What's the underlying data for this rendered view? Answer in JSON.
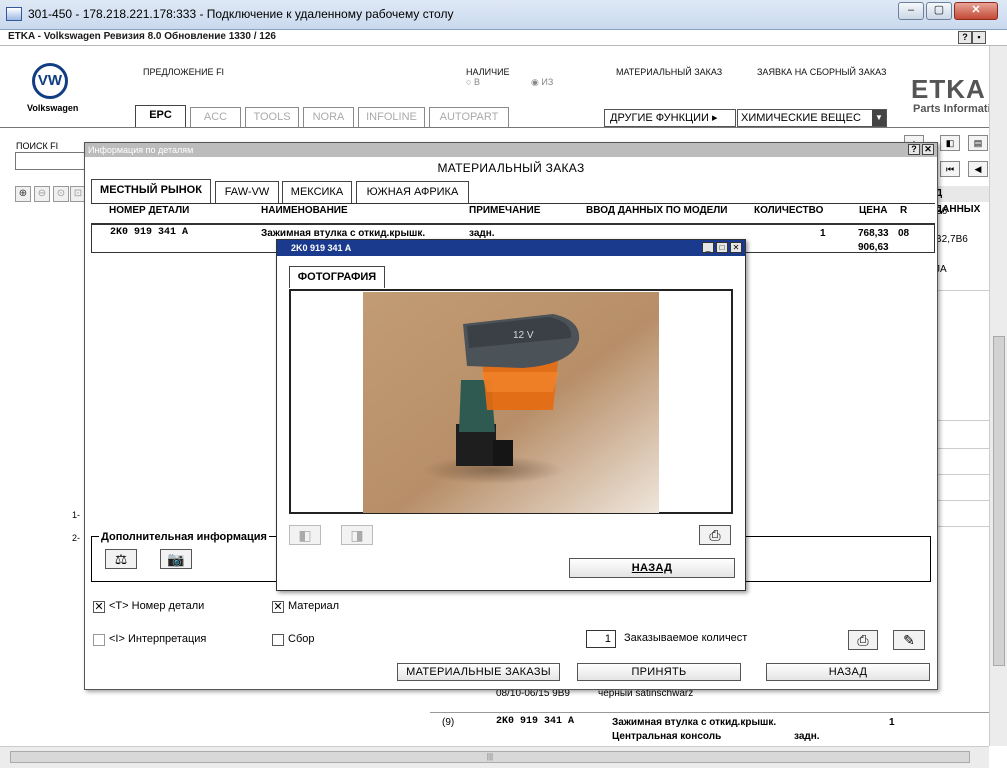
{
  "rdp": {
    "title": "301-450 - 178.218.221.178:333 - Подключение к удаленному рабочему столу"
  },
  "app": {
    "title": "ETKA - Volkswagen Ревизия 8.0 Обновление 1330 / 126"
  },
  "header": {
    "brand": "Volkswagen",
    "brand_logo": "VW",
    "proposal_fi": "ПРЕДЛОЖЕНИЕ FI",
    "availability": "НАЛИЧИЕ",
    "avail_in": "В",
    "avail_from": "ИЗ",
    "material_order": "МАТЕРИАЛЬНЫЙ ЗАКАЗ",
    "assembly_request": "ЗАЯВКА НА СБОРНЫЙ ЗАКАЗ",
    "etka_logo": "ETKA",
    "etka_sub": "Parts Informati",
    "other_functions": "ДРУГИЕ ФУНКЦИИ ▸",
    "chemicals": "ХИМИЧЕСКИЕ ВЕЩЕС"
  },
  "tabs": [
    "EPC",
    "ACC",
    "TOOLS",
    "NORA",
    "INFOLINE",
    "AUTOPART"
  ],
  "search": {
    "label": "ПОИСК FI"
  },
  "background_right": [
    "Д ДАННЫХ",
    "B6",
    "B2,7B6",
    "JA"
  ],
  "background_left": [
    "1-",
    "2-"
  ],
  "background_bottom": {
    "row1_years": "08/10-06/15 9B9",
    "row1_desc": "чёрный satinschwarz",
    "row2_pos": "(9)",
    "row2_part": "2K0 919 341 A",
    "row2_name": "Зажимная втулка с откид.крышк.",
    "row2_qty": "1",
    "row2_sub": "Центральная консоль",
    "row2_note": "задн."
  },
  "main_dialog": {
    "title": "Информация по деталям",
    "heading": "МАТЕРИАЛЬНЫЙ ЗАКАЗ",
    "markets": [
      "МЕСТНЫЙ РЫНОК",
      "FAW-VW",
      "МЕКСИКА",
      "ЮЖНАЯ АФРИКА"
    ],
    "columns": {
      "part_no": "НОМЕР ДЕТАЛИ",
      "name": "НАИМЕНОВАНИЕ",
      "note": "ПРИМЕЧАНИЕ",
      "model_data": "ВВОД ДАННЫХ ПО МОДЕЛИ",
      "qty": "КОЛИЧЕСТВО",
      "price": "ЦЕНА",
      "r": "R"
    },
    "row": {
      "part_no": "2K0 919 341 A",
      "name": "Зажимная втулка с откид.крышк.",
      "note": "задн.",
      "qty": "1",
      "price1": "768,33",
      "price2": "906,63",
      "r": "08"
    },
    "additional_info": "Дополнительная информация",
    "chk_part_no": "<T> Номер детали",
    "chk_material": "Материал",
    "chk_interpretation": "<I> Интерпретация",
    "chk_assembly": "Сбор",
    "order_qty_value": "1",
    "order_qty_label": "Заказываемое количест",
    "btn_material_orders": "МАТЕРИАЛЬНЫЕ ЗАКАЗЫ",
    "btn_accept": "ПРИНЯТЬ",
    "btn_back": "НАЗАД"
  },
  "photo_dialog": {
    "title": "2K0 919 341 A",
    "tab": "ФОТОГРАФИЯ",
    "cap_label": "12 V",
    "btn_back": "НАЗАД"
  },
  "colors": {
    "titlebar_blue": "#1a3a8e",
    "vw_blue": "#113d82",
    "part_orange": "#e86a10",
    "part_teal": "#2f5a52"
  }
}
